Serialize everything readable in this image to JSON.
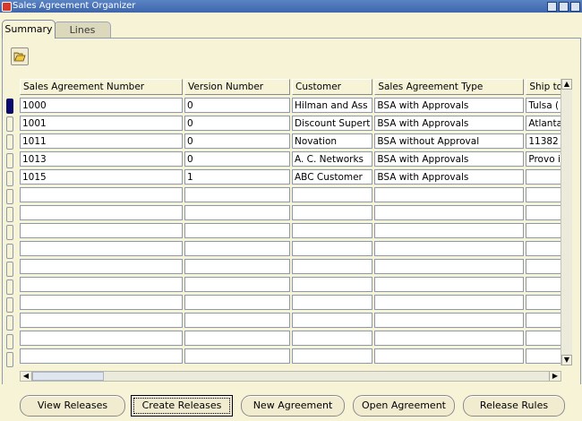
{
  "window": {
    "title": "Sales Agreement Organizer"
  },
  "tabs": [
    {
      "label": "Summary"
    },
    {
      "label": "Lines"
    }
  ],
  "toolbar": {
    "open_icon": "folder-open-icon"
  },
  "table": {
    "columns": [
      "Sales Agreement Number",
      "Version Number",
      "Customer",
      "Sales Agreement Type",
      "Ship to"
    ],
    "rows": [
      [
        "1000",
        "0",
        "Hilman and Ass",
        "BSA with Approvals",
        "Tulsa ("
      ],
      [
        "1001",
        "0",
        "Discount Supert",
        "BSA with Approvals",
        "Atlanta"
      ],
      [
        "1011",
        "0",
        "Novation",
        "BSA without Approval",
        "11382"
      ],
      [
        "1013",
        "0",
        "A. C. Networks",
        "BSA with Approvals",
        "Provo i"
      ],
      [
        "1015",
        "1",
        "ABC Customer",
        "BSA with Approvals",
        ""
      ],
      [
        "",
        "",
        "",
        "",
        ""
      ],
      [
        "",
        "",
        "",
        "",
        ""
      ],
      [
        "",
        "",
        "",
        "",
        ""
      ],
      [
        "",
        "",
        "",
        "",
        ""
      ],
      [
        "",
        "",
        "",
        "",
        ""
      ],
      [
        "",
        "",
        "",
        "",
        ""
      ],
      [
        "",
        "",
        "",
        "",
        ""
      ],
      [
        "",
        "",
        "",
        "",
        ""
      ],
      [
        "",
        "",
        "",
        "",
        ""
      ],
      [
        "",
        "",
        "",
        "",
        ""
      ]
    ]
  },
  "buttons": {
    "view_releases": "View Releases",
    "create_releases": "Create Releases",
    "new_agreement": "New Agreement",
    "open_agreement": "Open Agreement",
    "release_rules": "Release Rules"
  }
}
